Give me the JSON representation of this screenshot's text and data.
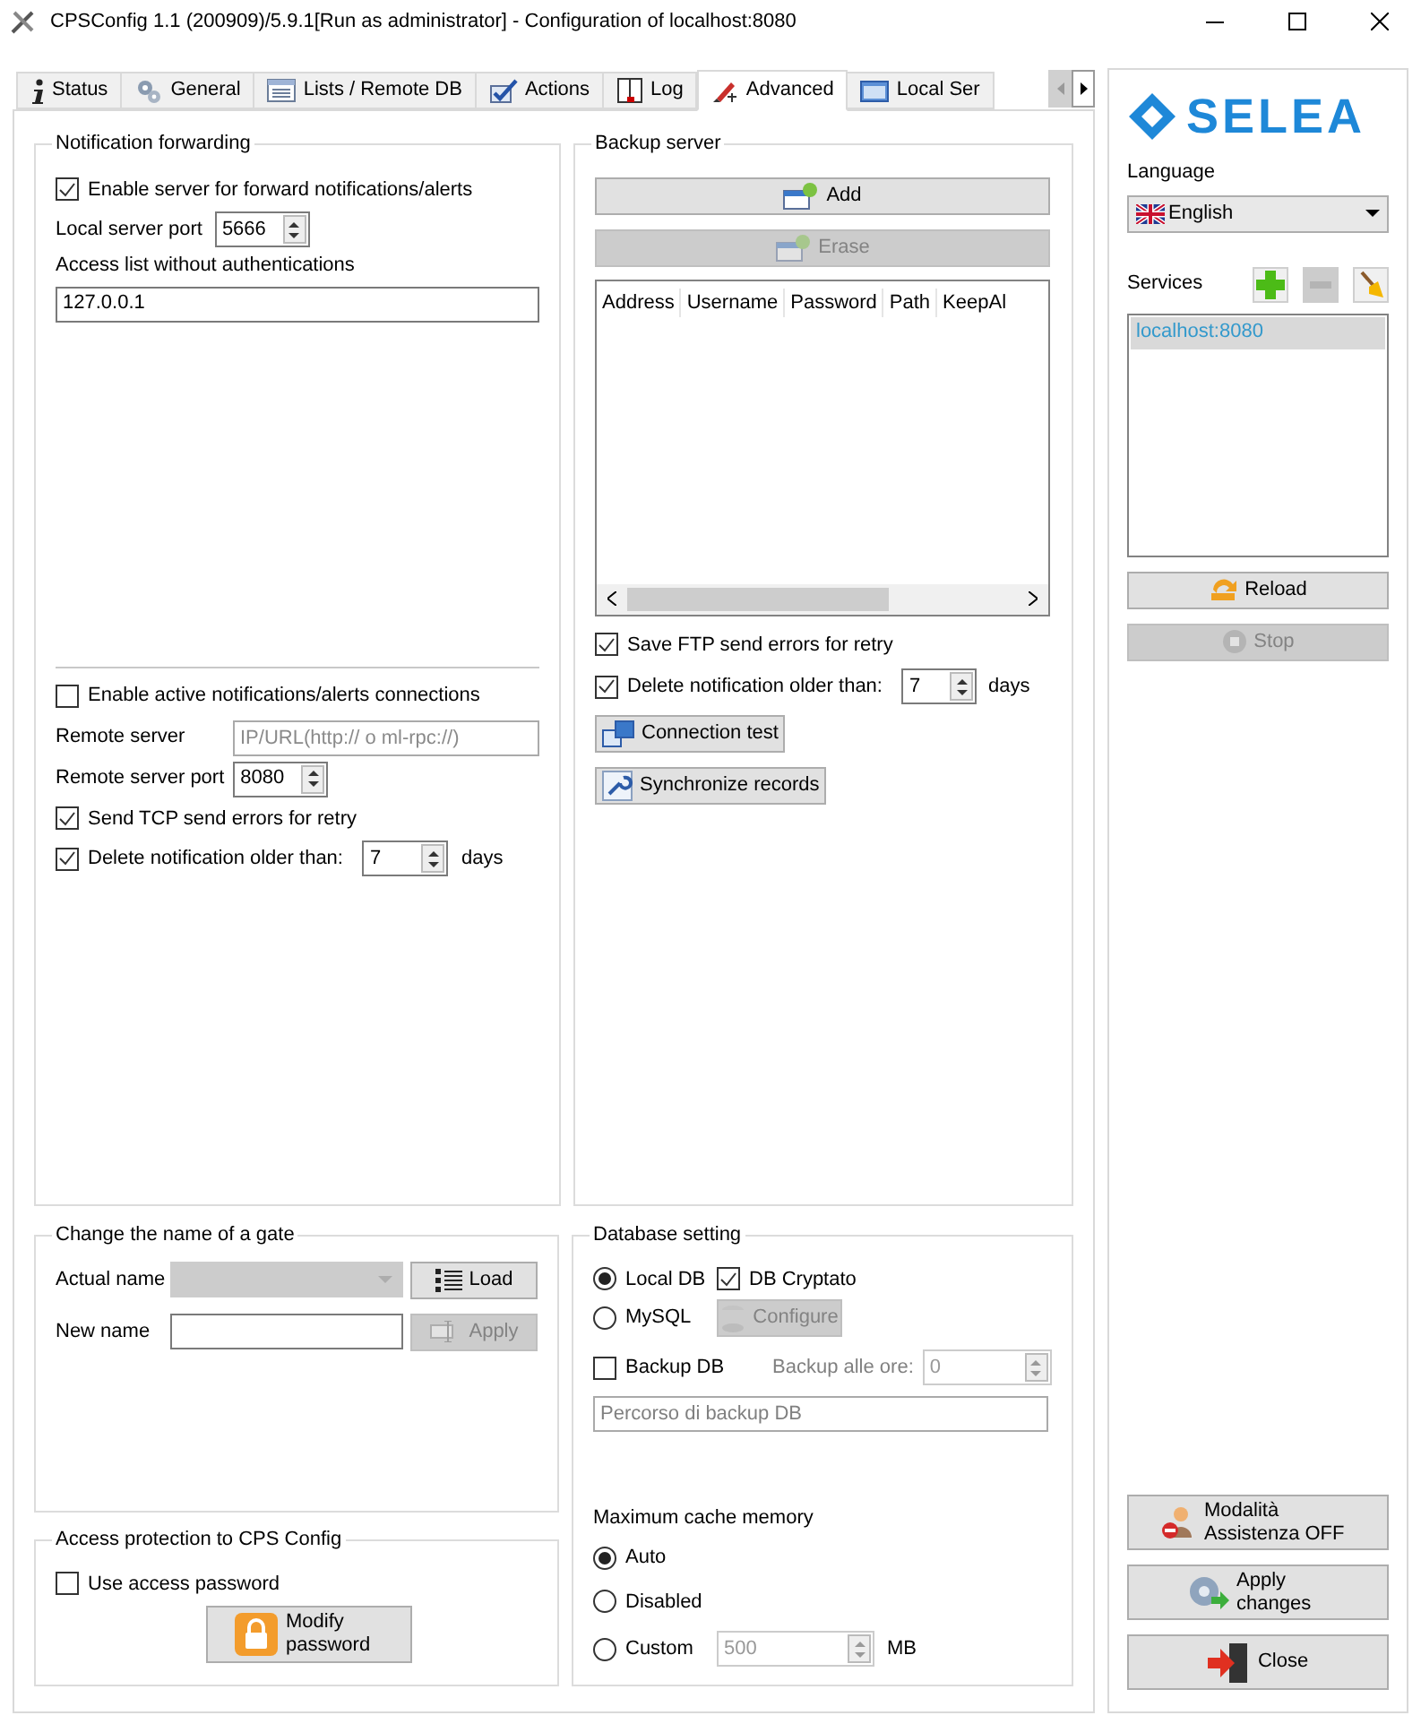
{
  "window": {
    "title": "CPSConfig 1.1 (200909)/5.9.1[Run as administrator] - Configuration of localhost:8080"
  },
  "tabs": [
    {
      "label": "Status",
      "selected": false
    },
    {
      "label": "General",
      "selected": false
    },
    {
      "label": "Lists / Remote DB",
      "selected": false
    },
    {
      "label": "Actions",
      "selected": false
    },
    {
      "label": "Log",
      "selected": false
    },
    {
      "label": "Advanced",
      "selected": true
    },
    {
      "label": "Local Ser",
      "selected": false
    }
  ],
  "notification_forwarding": {
    "title": "Notification forwarding",
    "enable_server": {
      "label": "Enable server for forward notifications/alerts",
      "checked": true
    },
    "local_port": {
      "label": "Local server port",
      "value": "5666"
    },
    "access_list": {
      "label": "Access list without authentications",
      "value": "127.0.0.1"
    },
    "enable_active": {
      "label": "Enable active notifications/alerts connections",
      "checked": false
    },
    "remote_server": {
      "label": "Remote server",
      "placeholder": "IP/URL(http:// o ml-rpc://)"
    },
    "remote_port": {
      "label": "Remote server port",
      "value": "8080"
    },
    "send_tcp": {
      "label": "Send TCP send errors for retry",
      "checked": true
    },
    "delete_older": {
      "label": "Delete notification older than:",
      "checked": true,
      "value": "7",
      "unit": "days"
    }
  },
  "backup_server": {
    "title": "Backup server",
    "buttons": [
      {
        "label": "Add",
        "disabled": false
      },
      {
        "label": "Erase",
        "disabled": true
      }
    ],
    "table": {
      "columns": [
        "Address",
        "Username",
        "Password",
        "Path",
        "KeepAl"
      ]
    },
    "save_ftp": {
      "label": "Save FTP send errors for retry",
      "checked": true
    },
    "delete_older": {
      "label": "Delete notification older than:",
      "checked": true,
      "value": "7",
      "unit": "days"
    },
    "actions": [
      {
        "label": "Connection test"
      },
      {
        "label": "Synchronize records"
      }
    ]
  },
  "change_name": {
    "title": "Change the name of a gate",
    "actual_name": {
      "label": "Actual name",
      "disabled": true
    },
    "load_button": {
      "label": "Load",
      "disabled": false
    },
    "new_name": {
      "label": "New name"
    },
    "apply_button": {
      "label": "Apply",
      "disabled": true
    }
  },
  "access_protection": {
    "title": "Access protection to CPS Config",
    "use_password": {
      "label": "Use access password",
      "checked": false
    },
    "modify_button": {
      "label": "Modify password"
    }
  },
  "database": {
    "title": "Database setting",
    "db_types": [
      {
        "label": "Local DB",
        "selected": true
      },
      {
        "label": "MySQL",
        "selected": false
      }
    ],
    "cryptato": {
      "label": "DB Cryptato",
      "checked": true
    },
    "configure_button": {
      "label": "Configure",
      "disabled": true
    },
    "backup_db": {
      "label": "Backup DB",
      "checked": false
    },
    "backup_hour": {
      "label": "Backup alle ore:",
      "value": "0",
      "disabled": true
    },
    "backup_path": {
      "placeholder": "Percorso di backup DB"
    },
    "cache_title": "Maximum cache memory",
    "cache_options": [
      {
        "label": "Auto",
        "selected": true
      },
      {
        "label": "Disabled",
        "selected": false
      },
      {
        "label": "Custom",
        "selected": false
      }
    ],
    "custom_size": {
      "value": "500",
      "unit": "MB",
      "disabled": true
    }
  },
  "sidebar": {
    "logo": "SELEA",
    "language_label": "Language",
    "language": "English",
    "services_label": "Services",
    "service_buttons": [
      {
        "disabled": false
      },
      {
        "disabled": true
      },
      {
        "disabled": false
      }
    ],
    "services": [
      {
        "label": "localhost:8080",
        "selected": true
      }
    ],
    "reload_button": {
      "label": "Reload",
      "disabled": false
    },
    "stop_button": {
      "label": "Stop",
      "disabled": true
    },
    "bottom_buttons": [
      {
        "label": "Modalità Assistenza OFF"
      },
      {
        "label": "Apply changes"
      },
      {
        "label": "Close"
      }
    ]
  }
}
